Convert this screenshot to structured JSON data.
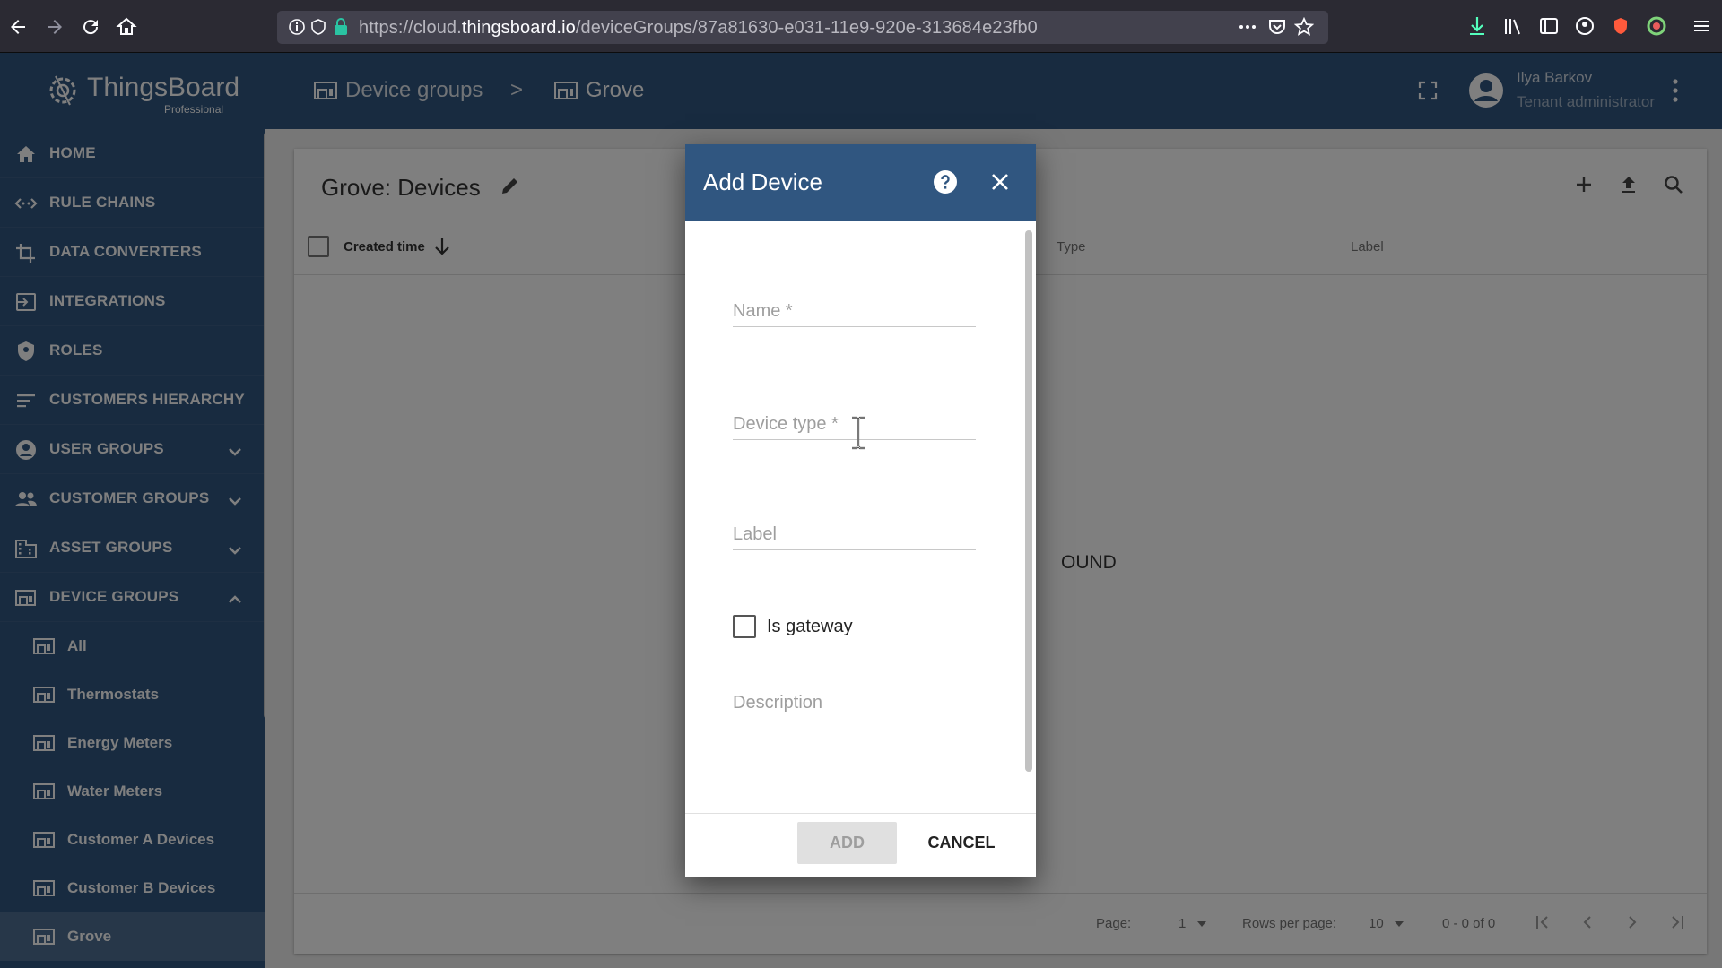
{
  "browser": {
    "url_prefix": "https://cloud.",
    "url_domain": "thingsboard.io",
    "url_path": "/deviceGroups/87a81630-e031-11e9-920e-313684e23fb0"
  },
  "app": {
    "logo_text": "ThingsBoard",
    "logo_sub": "Professional"
  },
  "sidebar": {
    "items": [
      {
        "label": "HOME",
        "icon": "home-icon"
      },
      {
        "label": "RULE CHAINS",
        "icon": "rule-chains-icon"
      },
      {
        "label": "DATA CONVERTERS",
        "icon": "data-converters-icon"
      },
      {
        "label": "INTEGRATIONS",
        "icon": "integrations-icon"
      },
      {
        "label": "ROLES",
        "icon": "shield-icon"
      },
      {
        "label": "CUSTOMERS HIERARCHY",
        "icon": "hierarchy-icon"
      },
      {
        "label": "USER GROUPS",
        "icon": "user-icon"
      },
      {
        "label": "CUSTOMER GROUPS",
        "icon": "people-icon"
      },
      {
        "label": "ASSET GROUPS",
        "icon": "domain-icon"
      },
      {
        "label": "DEVICE GROUPS",
        "icon": "devices-icon"
      }
    ],
    "device_groups": [
      {
        "label": "All"
      },
      {
        "label": "Thermostats"
      },
      {
        "label": "Energy Meters"
      },
      {
        "label": "Water Meters"
      },
      {
        "label": "Customer A Devices"
      },
      {
        "label": "Customer B Devices"
      },
      {
        "label": "Grove"
      }
    ]
  },
  "header": {
    "crumb1": "Device groups",
    "separator": ">",
    "crumb2": "Grove",
    "user_name": "Ilya Barkov",
    "user_role": "Tenant administrator"
  },
  "card": {
    "title": "Grove: Devices",
    "columns": {
      "created_time": "Created time",
      "type": "Type",
      "label": "Label"
    },
    "no_data": "OUND"
  },
  "footer": {
    "page_label": "Page:",
    "page_value": "1",
    "rows_label": "Rows per page:",
    "rows_value": "10",
    "range": "0 - 0 of 0"
  },
  "dialog": {
    "title": "Add Device",
    "name_label": "Name *",
    "device_type_label": "Device type *",
    "label_label": "Label",
    "is_gateway_label": "Is gateway",
    "description_label": "Description",
    "add_label": "ADD",
    "cancel_label": "CANCEL"
  },
  "colors": {
    "primary": "#305680",
    "sidebar": "#305680",
    "background": "#eeeeee"
  }
}
